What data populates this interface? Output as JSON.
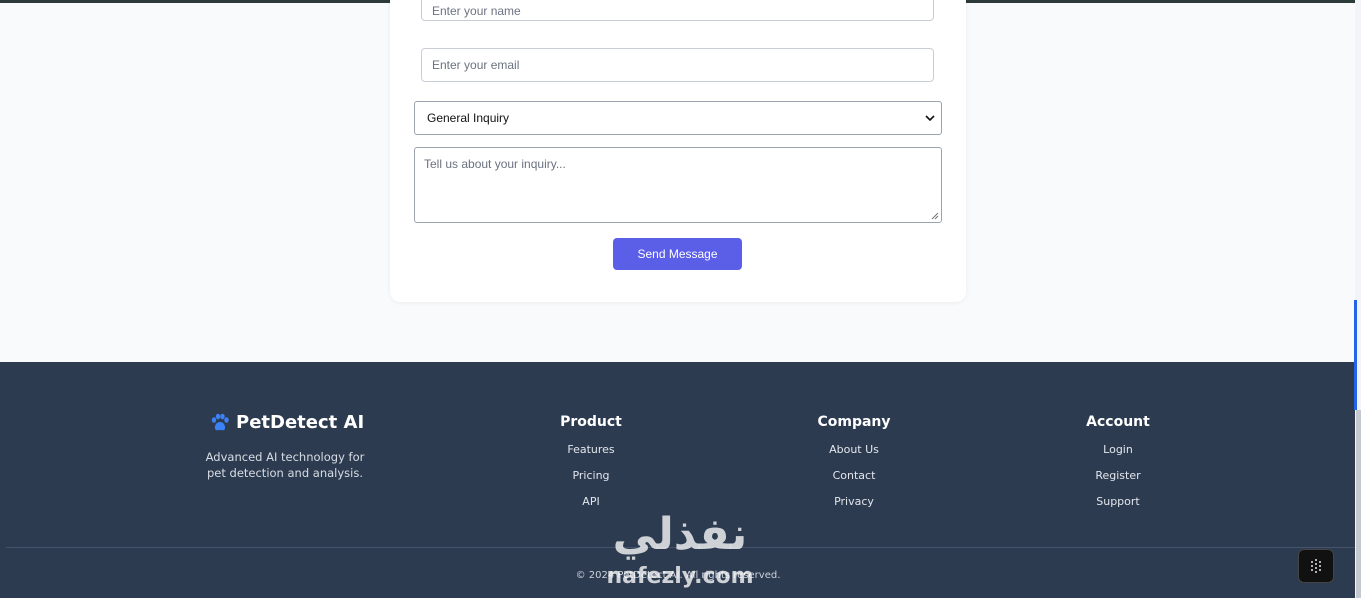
{
  "form": {
    "name_placeholder": "Enter your name",
    "email_placeholder": "Enter your email",
    "inquiry_selected": "General Inquiry",
    "message_placeholder": "Tell us about your inquiry...",
    "send_label": "Send Message"
  },
  "footer": {
    "brand_name": "PetDetect AI",
    "tagline": "Advanced AI technology for pet detection and analysis.",
    "columns": [
      {
        "title": "Product",
        "links": [
          "Features",
          "Pricing",
          "API"
        ]
      },
      {
        "title": "Company",
        "links": [
          "About Us",
          "Contact",
          "Privacy"
        ]
      },
      {
        "title": "Account",
        "links": [
          "Login",
          "Register",
          "Support"
        ]
      }
    ],
    "copyright": "© 2024 PetDetect AI. All rights reserved."
  },
  "watermark": {
    "arabic": "نفذلي",
    "latin": "nafezly.com"
  },
  "icons": {
    "brand": "paw-icon",
    "select": "chevron-down-icon"
  },
  "colors": {
    "accent": "#5b5fe8",
    "footer_bg": "#2d3b50",
    "brand_paw": "#3b82f6"
  }
}
